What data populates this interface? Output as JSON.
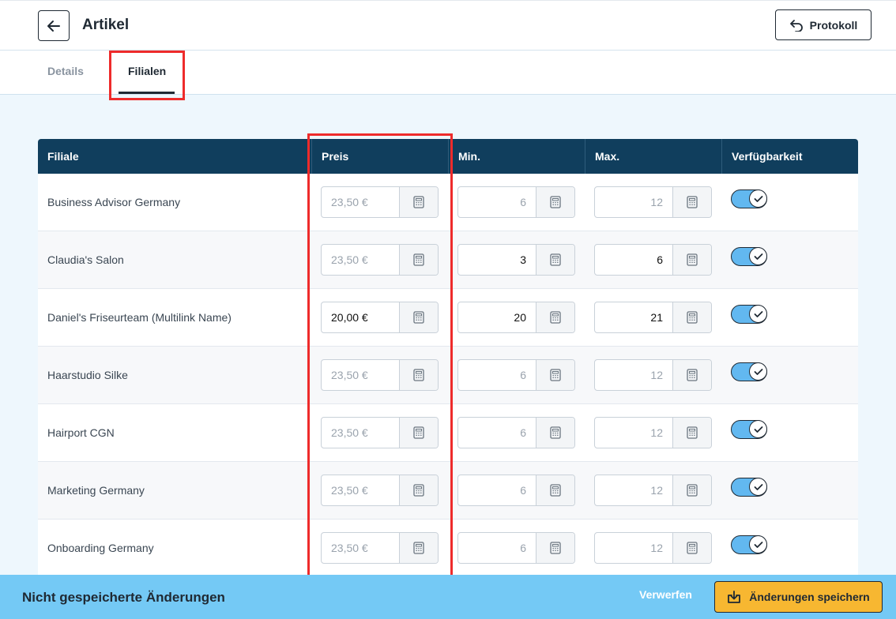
{
  "header": {
    "title": "Artikel",
    "protokoll_label": "Protokoll"
  },
  "tabs": [
    {
      "label": "Details",
      "active": false
    },
    {
      "label": "Filialen",
      "active": true
    }
  ],
  "table": {
    "columns": [
      "Filiale",
      "Preis",
      "Min.",
      "Max.",
      "Verfügbarkeit"
    ],
    "rows": [
      {
        "filiale": "Business Advisor Germany",
        "preis": "23,50 €",
        "preis_filled": false,
        "min": "6",
        "min_filled": false,
        "max": "12",
        "max_filled": false,
        "available": true
      },
      {
        "filiale": "Claudia's Salon",
        "preis": "23,50 €",
        "preis_filled": false,
        "min": "3",
        "min_filled": true,
        "max": "6",
        "max_filled": true,
        "available": true
      },
      {
        "filiale": "Daniel's Friseurteam (Multilink Name)",
        "preis": "20,00 €",
        "preis_filled": true,
        "min": "20",
        "min_filled": true,
        "max": "21",
        "max_filled": true,
        "available": true
      },
      {
        "filiale": "Haarstudio Silke",
        "preis": "23,50 €",
        "preis_filled": false,
        "min": "6",
        "min_filled": false,
        "max": "12",
        "max_filled": false,
        "available": true
      },
      {
        "filiale": "Hairport CGN",
        "preis": "23,50 €",
        "preis_filled": false,
        "min": "6",
        "min_filled": false,
        "max": "12",
        "max_filled": false,
        "available": true
      },
      {
        "filiale": "Marketing Germany",
        "preis": "23,50 €",
        "preis_filled": false,
        "min": "6",
        "min_filled": false,
        "max": "12",
        "max_filled": false,
        "available": true
      },
      {
        "filiale": "Onboarding Germany",
        "preis": "23,50 €",
        "preis_filled": false,
        "min": "6",
        "min_filled": false,
        "max": "12",
        "max_filled": false,
        "available": true
      }
    ]
  },
  "footer": {
    "message": "Nicht gespeicherte Änderungen",
    "discard_label": "Verwerfen",
    "save_label": "Änderungen speichern"
  },
  "icons": {
    "back": "arrow-left-icon",
    "protokoll": "undo-arrow-icon",
    "calculator": "calculator-icon",
    "check": "check-icon",
    "save": "download-tray-icon"
  },
  "colors": {
    "header_bg": "#103e5d",
    "toggle_on": "#62b8f0",
    "footer_bg": "#74c9f5",
    "save_button": "#f7b731",
    "highlight": "#ee2b2b"
  }
}
